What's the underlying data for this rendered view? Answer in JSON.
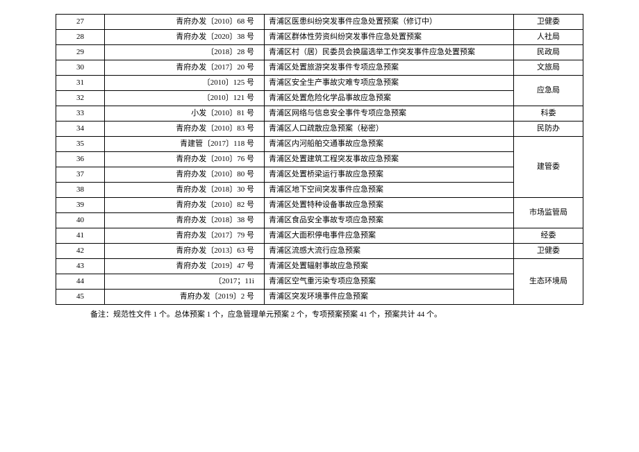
{
  "rows": [
    {
      "idx": "27",
      "doc": "青府办发〔2010〕68 号",
      "desc": "青浦区医患纠纷突发事件应急处置预案（修订中）",
      "dept": "卫健委",
      "deptRowspan": 1
    },
    {
      "idx": "28",
      "doc": "青府办发〔2020〕38 号",
      "desc": "青浦区群体性劳资纠纷突发事件应急处置预案",
      "dept": "人社局",
      "deptRowspan": 1
    },
    {
      "idx": "29",
      "doc": "〔2018〕28 号",
      "desc": "青浦区村（居）民委员会换届选举工作突发事件应急处置预案",
      "dept": "民政局",
      "deptRowspan": 1
    },
    {
      "idx": "30",
      "doc": "青府办发〔2017〕20 号",
      "desc": "青浦区处置旅游突发事件专项应急预案",
      "dept": "文旅局",
      "deptRowspan": 1
    },
    {
      "idx": "31",
      "doc": "〔2010〕125 号",
      "desc": "青浦区安全生产事故灾难专项应急预案",
      "dept": "应急局",
      "deptRowspan": 2
    },
    {
      "idx": "32",
      "doc": "〔2010〕121 号",
      "desc": "青浦区处置危险化学品事故应急预案",
      "dept": null
    },
    {
      "idx": "33",
      "doc": "小发〔2010〕81 号",
      "desc": "青浦区网络与信息安全事件专项应急预案",
      "dept": "科委",
      "deptRowspan": 1
    },
    {
      "idx": "34",
      "doc": "青府办发〔2010〕83 号",
      "desc": "青浦区人口疏散应急预案（秘密）",
      "dept": "民防办",
      "deptRowspan": 1
    },
    {
      "idx": "35",
      "doc": "青建管〔2017〕118 号",
      "desc": "青浦区内河船舶交通事故应急预案",
      "dept": "建管委",
      "deptRowspan": 4
    },
    {
      "idx": "36",
      "doc": "青府办发〔2010〕76 号",
      "desc": "青浦区处置建筑工程突发事故应急预案",
      "dept": null
    },
    {
      "idx": "37",
      "doc": "青府办发〔2010〕80 号",
      "desc": "青浦区处置桥梁运行事故应急预案",
      "dept": null
    },
    {
      "idx": "38",
      "doc": "青府办发〔2018〕30 号",
      "desc": "青浦区地下空间突发事件应急预案",
      "dept": null
    },
    {
      "idx": "39",
      "doc": "青府办发〔2010〕82 号",
      "desc": "青浦区处置特种设备事故应急预案",
      "dept": "市场监管局",
      "deptRowspan": 2
    },
    {
      "idx": "40",
      "doc": "青府办发〔2018〕38 号",
      "desc": "青浦区食品安全事故专项应急预案",
      "dept": null
    },
    {
      "idx": "41",
      "doc": "青府办发〔2017〕79 号",
      "desc": "青浦区大面积停电事件应急预案",
      "dept": "经委",
      "deptRowspan": 1
    },
    {
      "idx": "42",
      "doc": "青府办发〔2013〕63 号",
      "desc": "青浦区流感大流行应急预案",
      "dept": "卫健委",
      "deptRowspan": 1
    },
    {
      "idx": "43",
      "doc": "青府办发〔2019〕47 号",
      "desc": "青浦区处置辐射事故应急预案",
      "dept": "生态环境局",
      "deptRowspan": 3
    },
    {
      "idx": "44",
      "doc": "〔2017；11i",
      "desc": "青浦区空气重污染专项应急预案",
      "dept": null
    },
    {
      "idx": "45",
      "doc": "青府办发〔2019〕2 号",
      "desc": "青浦区突发环境事件应急预案",
      "dept": null
    }
  ],
  "footnote": "备注：规范性文件 1 个。总体预案 1 个，应急管理单元预案 2 个，专项预案预案 41 个，预案共计 44 个。"
}
